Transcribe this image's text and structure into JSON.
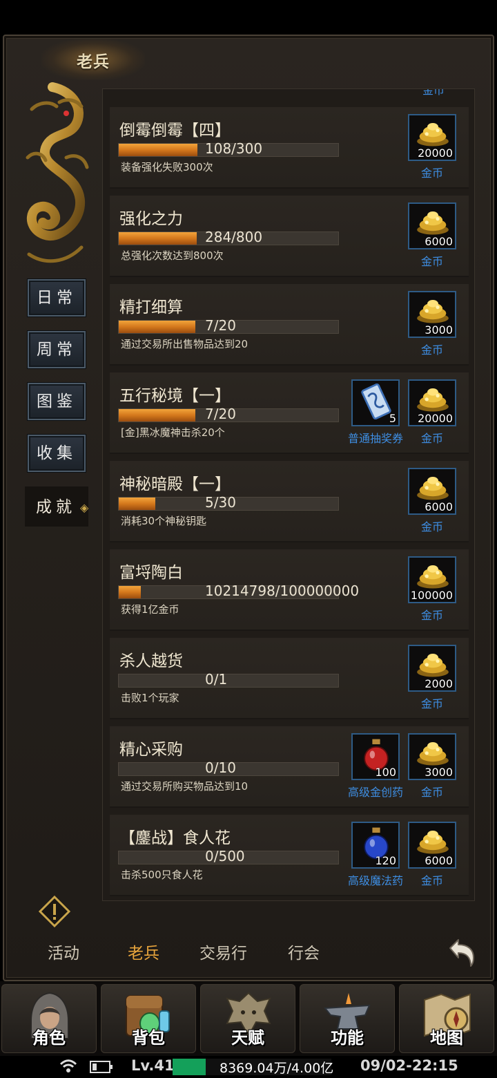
{
  "title": "老兵",
  "side_tabs": [
    {
      "label": "日常",
      "active": false
    },
    {
      "label": "周常",
      "active": false
    },
    {
      "label": "图鉴",
      "active": false
    },
    {
      "label": "收集",
      "active": false
    },
    {
      "label": "成就",
      "active": true
    }
  ],
  "top_peek_label": "金币",
  "achievements": [
    {
      "name": "倒霉倒霉【四】",
      "progress_text": "108/300",
      "progress": 0.36,
      "desc": "装备强化失败300次",
      "rewards": [
        {
          "icon": "gold-coins-icon",
          "count": "20000",
          "label": "金币"
        }
      ]
    },
    {
      "name": "强化之力",
      "progress_text": "284/800",
      "progress": 0.355,
      "desc": "总强化次数达到800次",
      "rewards": [
        {
          "icon": "gold-coins-icon",
          "count": "6000",
          "label": "金币"
        }
      ]
    },
    {
      "name": "精打细算",
      "progress_text": "7/20",
      "progress": 0.35,
      "desc": "通过交易所出售物品达到20",
      "rewards": [
        {
          "icon": "gold-coins-icon",
          "count": "3000",
          "label": "金币"
        }
      ]
    },
    {
      "name": "五行秘境【一】",
      "progress_text": "7/20",
      "progress": 0.35,
      "desc": "[金]黑冰魔神击杀20个",
      "rewards": [
        {
          "icon": "lottery-ticket-icon",
          "count": "5",
          "label": "普通抽奖券"
        },
        {
          "icon": "gold-coins-icon",
          "count": "20000",
          "label": "金币"
        }
      ]
    },
    {
      "name": "神秘暗殿【一】",
      "progress_text": "5/30",
      "progress": 0.167,
      "desc": "消耗30个神秘钥匙",
      "rewards": [
        {
          "icon": "gold-coins-icon",
          "count": "6000",
          "label": "金币"
        }
      ]
    },
    {
      "name": "富埒陶白",
      "progress_text": "10214798/100000000",
      "progress": 0.102,
      "desc": "获得1亿金币",
      "rewards": [
        {
          "icon": "gold-coins-icon",
          "count": "100000",
          "label": "金币"
        }
      ]
    },
    {
      "name": "杀人越货",
      "progress_text": "0/1",
      "progress": 0,
      "desc": "击败1个玩家",
      "rewards": [
        {
          "icon": "gold-coins-icon",
          "count": "2000",
          "label": "金币"
        }
      ]
    },
    {
      "name": "精心采购",
      "progress_text": "0/10",
      "progress": 0,
      "desc": "通过交易所购买物品达到10",
      "rewards": [
        {
          "icon": "red-potion-icon",
          "count": "100",
          "label": "高级金创药"
        },
        {
          "icon": "gold-coins-icon",
          "count": "3000",
          "label": "金币"
        }
      ]
    },
    {
      "name": "【鏖战】食人花",
      "progress_text": "0/500",
      "progress": 0,
      "desc": "击杀500只食人花",
      "rewards": [
        {
          "icon": "blue-potion-icon",
          "count": "120",
          "label": "高级魔法药"
        },
        {
          "icon": "gold-coins-icon",
          "count": "6000",
          "label": "金币"
        }
      ]
    }
  ],
  "bottom_tabs": [
    {
      "label": "活动",
      "active": false
    },
    {
      "label": "老兵",
      "active": true
    },
    {
      "label": "交易行",
      "active": false
    },
    {
      "label": "行会",
      "active": false
    }
  ],
  "nav": [
    {
      "label": "角色",
      "icon": "hooded-hero-icon"
    },
    {
      "label": "背包",
      "icon": "bag-icon"
    },
    {
      "label": "天赋",
      "icon": "dragon-emblem-icon"
    },
    {
      "label": "功能",
      "icon": "anvil-icon"
    },
    {
      "label": "地图",
      "icon": "map-compass-icon"
    }
  ],
  "status": {
    "level": "Lv.41",
    "exp": "8369.04万/4.00亿",
    "exp_progress": 0.21,
    "datetime": "09/02-22:15"
  },
  "colors": {
    "accent": "#e8a53c",
    "reward_label": "#3e8ee3",
    "bar_fill": "#d4781c",
    "exp_bar": "#14a05a"
  }
}
